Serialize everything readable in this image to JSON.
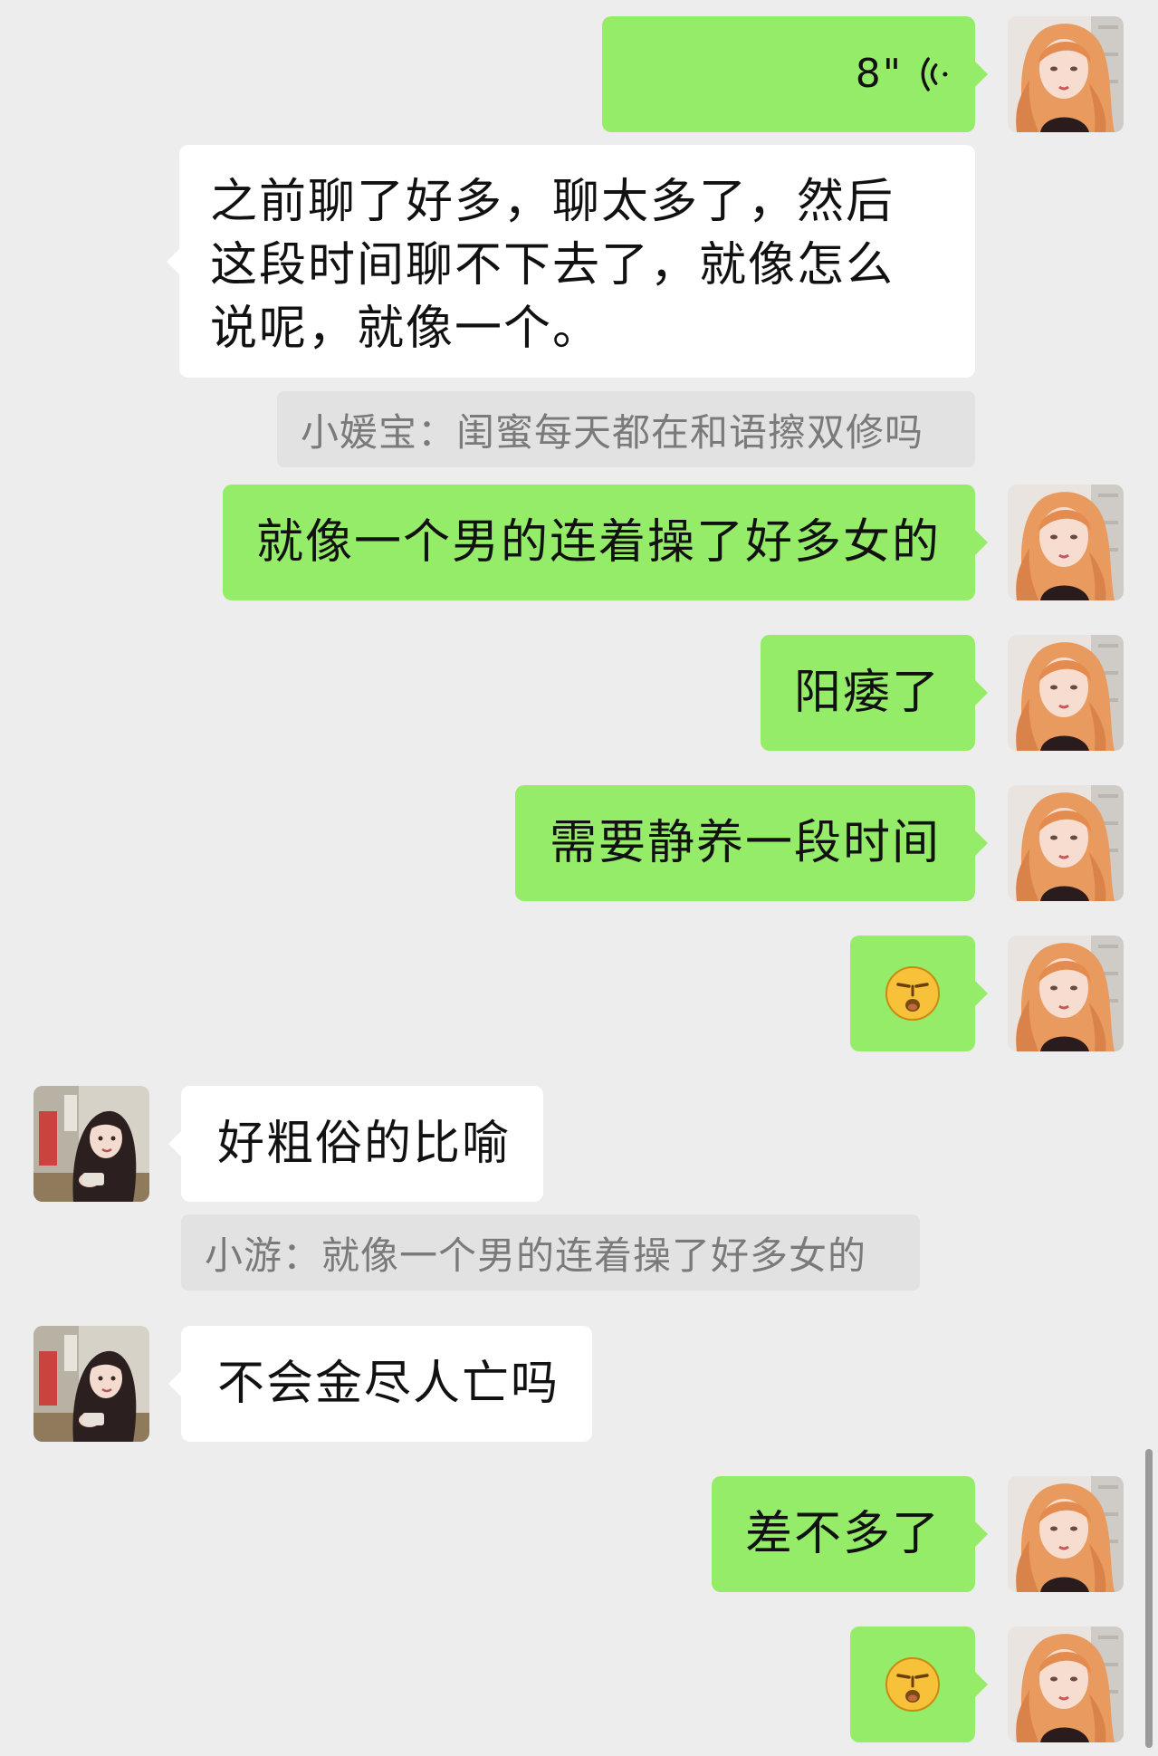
{
  "messages": [
    {
      "sender": "me",
      "type": "voice",
      "duration": "8\""
    },
    {
      "sender": "other",
      "type": "text",
      "text": "之前聊了好多，聊太多了，然后这段时间聊不下去了，就像怎么说呢，就像一个。"
    },
    {
      "type": "quote",
      "text": "小媛宝：闺蜜每天都在和语擦双修吗"
    },
    {
      "sender": "me",
      "type": "text",
      "text": "就像一个男的连着操了好多女的"
    },
    {
      "sender": "me",
      "type": "text",
      "text": "阳痿了"
    },
    {
      "sender": "me",
      "type": "text",
      "text": "需要静养一段时间"
    },
    {
      "sender": "me",
      "type": "emoji",
      "icon": "sad-face-emoji"
    },
    {
      "sender": "other",
      "type": "text",
      "text": "好粗俗的比喻"
    },
    {
      "type": "quote",
      "text": "小游：就像一个男的连着操了好多女的"
    },
    {
      "sender": "other",
      "type": "text",
      "text": "不会金尽人亡吗"
    },
    {
      "sender": "me",
      "type": "text",
      "text": "差不多了"
    },
    {
      "sender": "me",
      "type": "emoji",
      "icon": "sad-face-emoji"
    }
  ],
  "colors": {
    "background": "#ededed",
    "my_bubble": "#95ec69",
    "their_bubble": "#ffffff",
    "quote_bg": "#e2e2e2",
    "quote_text": "#7a7a7a"
  }
}
